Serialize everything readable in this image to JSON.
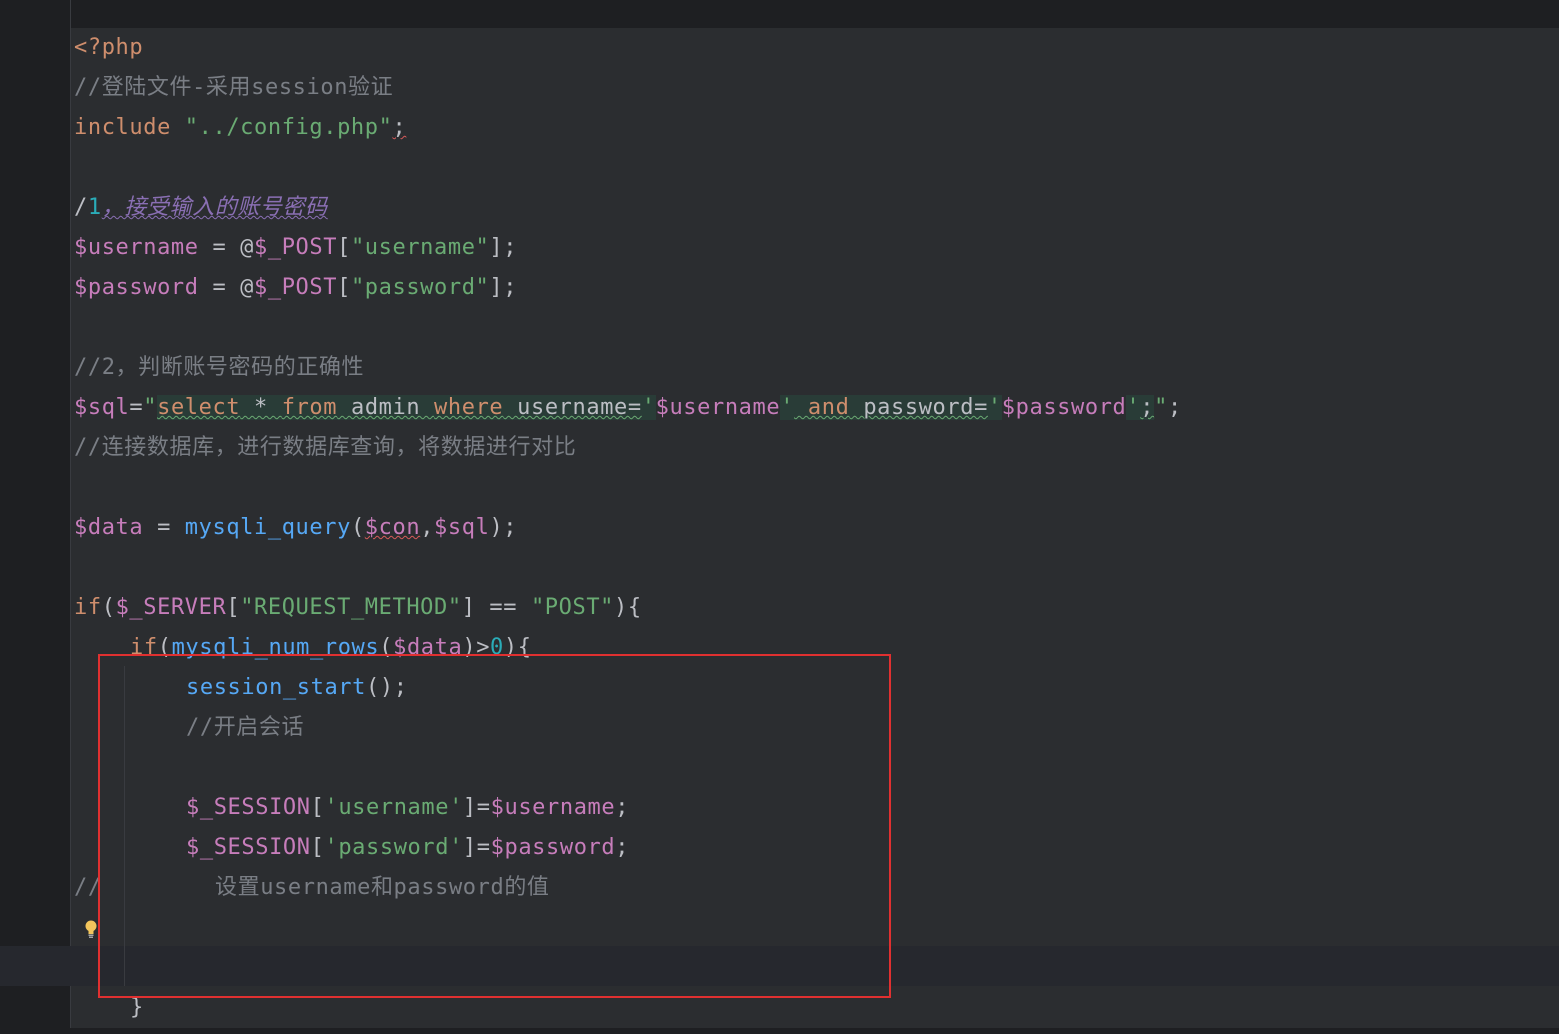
{
  "editor": {
    "language": "php",
    "lines": {
      "l1": "<?php",
      "l2": "//登陆文件-采用session验证",
      "l3_kw": "include",
      "l3_str": "\"../config.php\"",
      "l3_end": ";",
      "l5_slash": "/",
      "l5_num": "1",
      "l5_text": "，接受输入的账号密码",
      "l6_var": "$username",
      "l6_mid": " = @",
      "l6_post": "$_POST",
      "l6_open": "[",
      "l6_str": "\"username\"",
      "l6_close": "];",
      "l7_var": "$password",
      "l7_mid": " = @",
      "l7_post": "$_POST",
      "l7_open": "[",
      "l7_str": "\"password\"",
      "l7_close": "];",
      "l9": "//2，判断账号密码的正确性",
      "l10_var": "$sql",
      "l10_eq": "=",
      "l10_q": "\"",
      "l10_select": "select",
      "l10_star": " * ",
      "l10_from": "from",
      "l10_admin": " admin ",
      "l10_where": "where",
      "l10_username": " username=",
      "l10_sq1": "'",
      "l10_uvar": "$username",
      "l10_sq2": "'",
      "l10_and_sp": " ",
      "l10_and": "and",
      "l10_password": " password=",
      "l10_sq3": "'",
      "l10_pvar": "$password",
      "l10_sq4": "'",
      "l10_semi": ";",
      "l10_q2": "\"",
      "l10_end": ";",
      "l11": "//连接数据库，进行数据库查询，将数据进行对比",
      "l13_var": "$data",
      "l13_eq": " = ",
      "l13_fn": "mysqli_query",
      "l13_open": "(",
      "l13_con": "$con",
      "l13_comma": ",",
      "l13_sql": "$sql",
      "l13_close": ");",
      "l15_if": "if",
      "l15_open": "(",
      "l15_server": "$_SERVER",
      "l15_b1": "[",
      "l15_key": "\"REQUEST_METHOD\"",
      "l15_b2": "] == ",
      "l15_post": "\"POST\"",
      "l15_close": "){",
      "l16_if": "if",
      "l16_open": "(",
      "l16_fn": "mysqli_num_rows",
      "l16_p1": "(",
      "l16_data": "$data",
      "l16_p2": ")>",
      "l16_zero": "0",
      "l16_close": "){",
      "l17_fn": "session_start",
      "l17_end": "();",
      "l18": "//开启会话",
      "l20_sess": "$_SESSION",
      "l20_b1": "[",
      "l20_key": "'username'",
      "l20_b2": "]=",
      "l20_var": "$username",
      "l20_end": ";",
      "l21_sess": "$_SESSION",
      "l21_b1": "[",
      "l21_key": "'password'",
      "l21_b2": "]=",
      "l21_var": "$password",
      "l21_end": ";",
      "l22_slash": "//",
      "l22_text": "设置username和password的值",
      "l25": "}"
    }
  },
  "colors": {
    "keyword": "#cf8e6d",
    "variable": "#c77dbb",
    "string": "#6aab73",
    "function": "#56a8f5",
    "number": "#2aacb8",
    "comment": "#7a7e85",
    "highlight_box": "#e03030"
  },
  "icons": {
    "gutter_hint": "lightbulb-icon"
  }
}
